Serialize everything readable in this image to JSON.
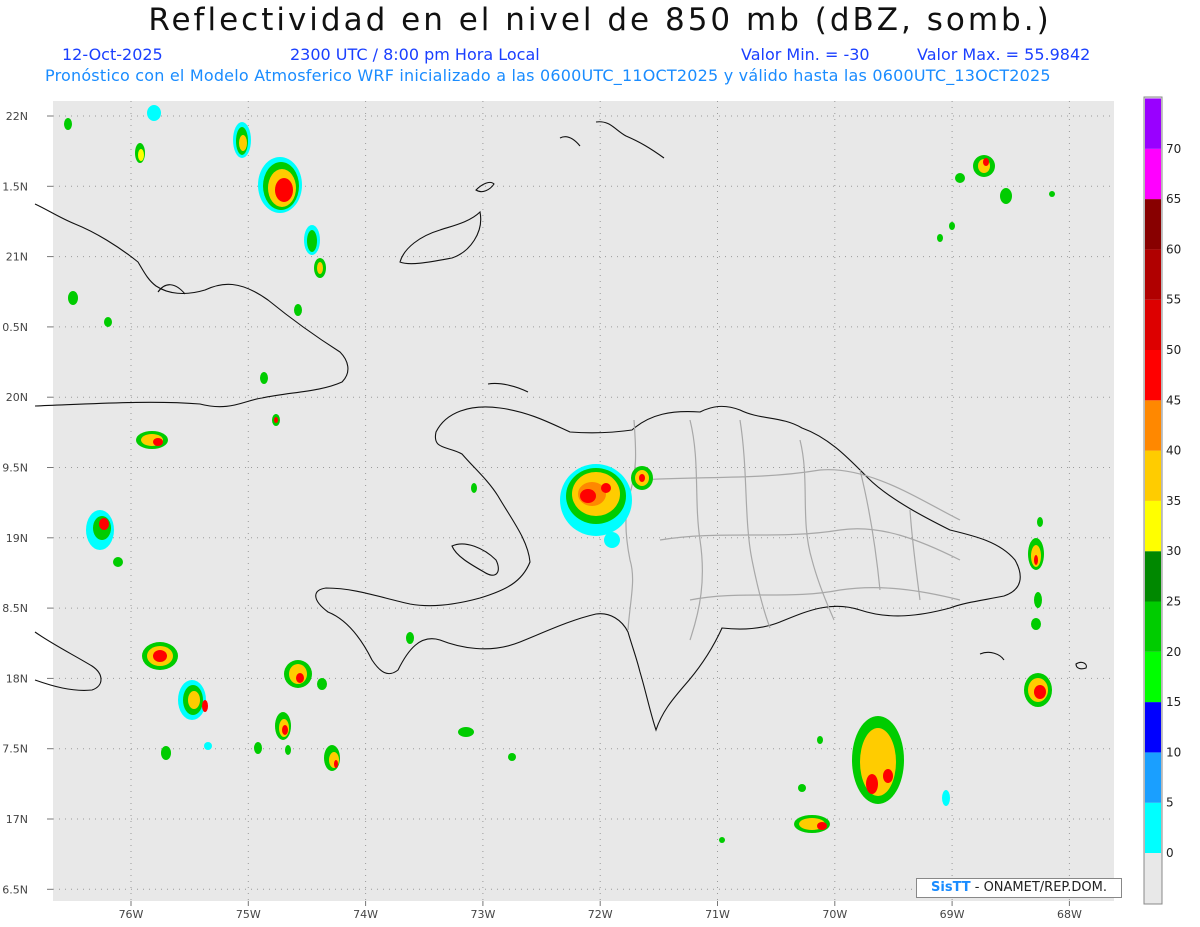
{
  "title": "Reflectividad en el nivel de 850 mb (dBZ, somb.)",
  "date": "12-Oct-2025",
  "time": "2300 UTC / 8:00 pm Hora Local",
  "valor_min": "Valor Min. = -30",
  "valor_max": "Valor Max. = 55.9842",
  "description": "Pronóstico con el Modelo Atmosferico WRF inicializado a las 0600UTC_11OCT2025 y válido hasta las  0600UTC_13OCT2025",
  "credit": {
    "logo": "SisTT",
    "text": "- ONAMET/REP.DOM."
  },
  "lat_labels": [
    "22N",
    "1.5N",
    "21N",
    "0.5N",
    "20N",
    "9.5N",
    "19N",
    "8.5N",
    "18N",
    "7.5N",
    "17N",
    "6.5N"
  ],
  "lon_labels": [
    "76W",
    "75W",
    "74W",
    "73W",
    "72W",
    "71W",
    "70W",
    "69W",
    "68W"
  ],
  "colorbar": {
    "labels": [
      "0",
      "5",
      "10",
      "15",
      "20",
      "25",
      "30",
      "35",
      "40",
      "45",
      "50",
      "55",
      "60",
      "65",
      "70"
    ],
    "colors": [
      "#00ffff",
      "#1a9fff",
      "#0000ff",
      "#00ff00",
      "#00cc00",
      "#008800",
      "#ffff00",
      "#ffcc00",
      "#ff8800",
      "#ff0000",
      "#dd0000",
      "#b00000",
      "#880000",
      "#ff00ff",
      "#9900ff"
    ]
  },
  "colors": {
    "sea": "#e8e8e8",
    "grid": "#9a9a9a",
    "coast": "#111111",
    "borders": "#a0a0a0"
  }
}
